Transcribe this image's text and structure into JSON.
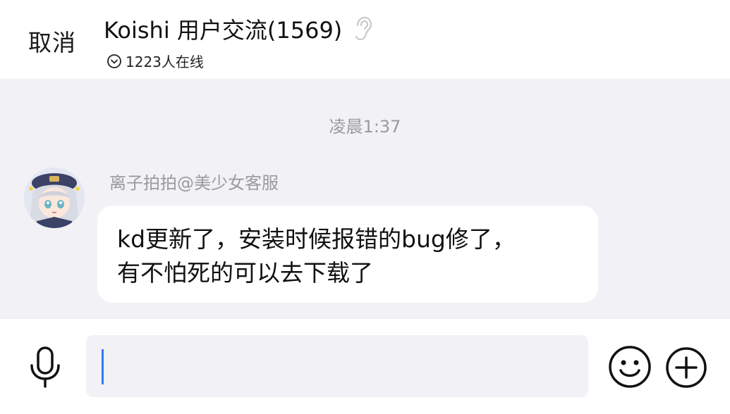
{
  "header": {
    "cancel_label": "取消",
    "title": "Koishi 用户交流(1569)",
    "online_text": "1223人在线"
  },
  "chat": {
    "timestamp": "凌晨1:37",
    "messages": [
      {
        "sender": "离子拍拍@美少女客服",
        "lines": [
          "kd更新了，安装时候报错的bug修了，",
          "有不怕死的可以去下载了"
        ]
      }
    ]
  },
  "input_bar": {
    "value": ""
  },
  "icons": {
    "ear": "ear-icon",
    "online": "chevron-circle-down-icon",
    "mic": "microphone-icon",
    "emoji": "smiley-icon",
    "plus": "plus-circle-icon"
  },
  "colors": {
    "background": "#f2f1f5",
    "bubble": "#ffffff",
    "caret": "#2f7cf6",
    "muted_text": "#9a9a9f"
  }
}
